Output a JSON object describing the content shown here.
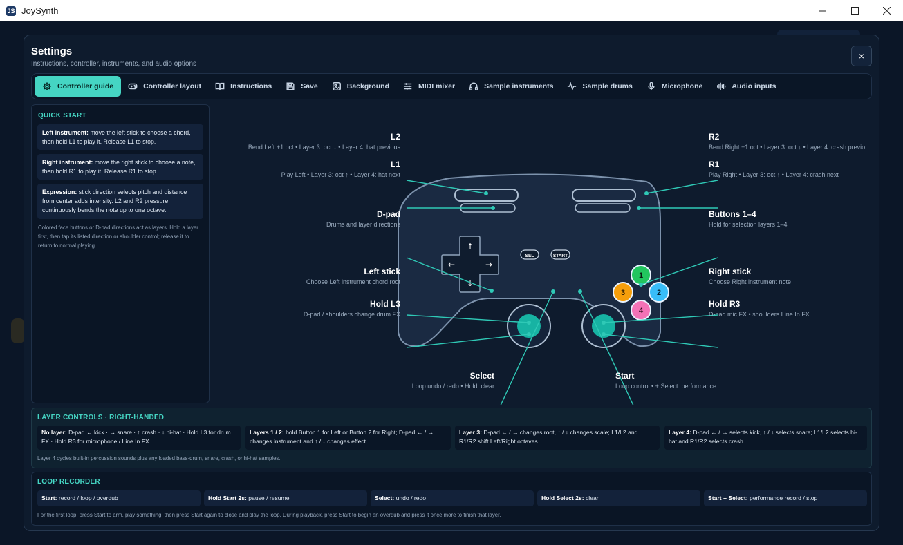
{
  "window": {
    "title": "JoySynth",
    "app_icon": "JS"
  },
  "modal": {
    "title": "Settings",
    "subtitle": "Instructions, controller, instruments, and audio options",
    "close_label": "×"
  },
  "tabs": [
    {
      "label": "Controller guide",
      "icon": "gear-icon",
      "active": true
    },
    {
      "label": "Controller layout",
      "icon": "gamepad-icon"
    },
    {
      "label": "Instructions",
      "icon": "book-icon"
    },
    {
      "label": "Save",
      "icon": "save-icon"
    },
    {
      "label": "Background",
      "icon": "image-icon"
    },
    {
      "label": "MIDI mixer",
      "icon": "sliders-icon"
    },
    {
      "label": "Sample instruments",
      "icon": "headphones-icon"
    },
    {
      "label": "Sample drums",
      "icon": "waveform-icon"
    },
    {
      "label": "Microphone",
      "icon": "microphone-icon"
    },
    {
      "label": "Audio inputs",
      "icon": "audio-bars-icon"
    }
  ],
  "quick_start": {
    "title": "QUICK START",
    "cards": [
      {
        "bold": "Left instrument:",
        "text": " move the left stick to choose a chord, then hold L1 to play it. Release L1 to stop."
      },
      {
        "bold": "Right instrument:",
        "text": " move the right stick to choose a note, then hold R1 to play it. Release R1 to stop."
      },
      {
        "bold": "Expression:",
        "text": " stick direction selects pitch and distance from center adds intensity. L2 and R2 pressure continuously bends the note up to one octave."
      }
    ],
    "note": "Colored face buttons or D-pad directions act as layers. Hold a layer first, then tap its listed direction or shoulder control; release it to return to normal playing."
  },
  "controller": {
    "face_buttons": [
      "1",
      "2",
      "3",
      "4"
    ],
    "select_label": "SEL",
    "start_label": "START",
    "dpad_arrows": {
      "up": "↑",
      "down": "↓",
      "left": "←",
      "right": "→"
    },
    "colors": {
      "accent": "#45d5c3",
      "button1": "#22c55e",
      "button2": "#38bdf8",
      "button3": "#f59e0b",
      "button4": "#f472b6"
    }
  },
  "labels": {
    "l2": {
      "title": "L2",
      "desc": "Bend Left +1 oct • Layer 3: oct ↓ • Layer 4: hat previous"
    },
    "l1": {
      "title": "L1",
      "desc": "Play Left • Layer 3: oct ↑ • Layer 4: hat next"
    },
    "dpad": {
      "title": "D-pad",
      "desc": "Drums and layer directions"
    },
    "left_stick": {
      "title": "Left stick",
      "desc": "Choose Left instrument chord root"
    },
    "hold_l3": {
      "title": "Hold L3",
      "desc": "D-pad / shoulders change drum FX"
    },
    "r2": {
      "title": "R2",
      "desc": "Bend Right +1 oct • Layer 3: oct ↓ • Layer 4: crash previo"
    },
    "r1": {
      "title": "R1",
      "desc": "Play Right • Layer 3: oct ↑ • Layer 4: crash next"
    },
    "buttons": {
      "title": "Buttons 1–4",
      "desc": "Hold for selection layers 1–4"
    },
    "right_stick": {
      "title": "Right stick",
      "desc": "Choose Right instrument note"
    },
    "hold_r3": {
      "title": "Hold R3",
      "desc": "D-pad mic FX • shoulders Line In FX"
    },
    "select": {
      "title": "Select",
      "desc": "Loop undo / redo • Hold: clear"
    },
    "start": {
      "title": "Start",
      "desc": "Loop control • + Select: performance"
    }
  },
  "layer_controls": {
    "title": "LAYER CONTROLS · RIGHT-HANDED",
    "cards": [
      {
        "bold": "No layer:",
        "text": " D-pad ← kick · → snare · ↑ crash · ↓ hi-hat · Hold L3 for drum FX · Hold R3 for microphone / Line In FX"
      },
      {
        "bold": "Layers 1 / 2:",
        "text": " hold Button 1 for Left or Button 2 for Right; D-pad ← / → changes instrument and ↑ / ↓ changes effect"
      },
      {
        "bold": "Layer 3:",
        "text": " D-pad ← / → changes root, ↑ / ↓ changes scale; L1/L2 and R1/R2 shift Left/Right octaves"
      },
      {
        "bold": "Layer 4:",
        "text": " D-pad ← / → selects kick, ↑ / ↓ selects snare; L1/L2 selects hi-hat and R1/R2 selects crash"
      }
    ],
    "note": "Layer 4 cycles built-in percussion sounds plus any loaded bass-drum, snare, crash, or hi-hat samples."
  },
  "loop_recorder": {
    "title": "LOOP RECORDER",
    "cards": [
      {
        "bold": "Start:",
        "text": " record / loop / overdub"
      },
      {
        "bold": "Hold Start 2s:",
        "text": " pause / resume"
      },
      {
        "bold": "Select:",
        "text": " undo / redo"
      },
      {
        "bold": "Hold Select 2s:",
        "text": " clear"
      },
      {
        "bold": "Start + Select:",
        "text": " performance record / stop"
      }
    ],
    "note": "For the first loop, press Start to arm, play something, then press Start again to close and play the loop. During playback, press Start to begin an overdub and press it once more to finish that layer."
  }
}
